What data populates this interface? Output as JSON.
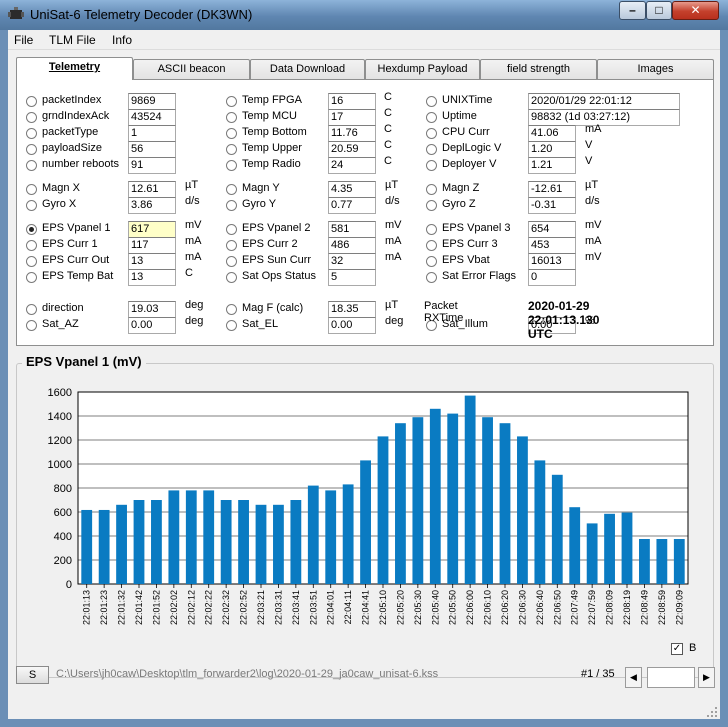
{
  "window": {
    "title": "UniSat-6 Telemetry Decoder (DK3WN)",
    "min_glyph": "–",
    "max_glyph": "□",
    "close_glyph": "✕"
  },
  "menu": {
    "items": [
      "File",
      "TLM File",
      "Info"
    ]
  },
  "tabs": [
    {
      "label": "Telemetry",
      "active": true
    },
    {
      "label": "ASCII beacon"
    },
    {
      "label": "Data Download"
    },
    {
      "label": "Hexdump Payload"
    },
    {
      "label": "field strength"
    },
    {
      "label": "Images"
    }
  ],
  "fields": {
    "col1": [
      {
        "label": "packetIndex",
        "value": "9869"
      },
      {
        "label": "grndIndexAck",
        "value": "43524"
      },
      {
        "label": "packetType",
        "value": "1"
      },
      {
        "label": "payloadSize",
        "value": "56"
      },
      {
        "label": "number reboots",
        "value": "91"
      }
    ],
    "col2": [
      {
        "label": "Temp FPGA",
        "value": "16",
        "unit": "C"
      },
      {
        "label": "Temp MCU",
        "value": "17",
        "unit": "C"
      },
      {
        "label": "Temp Bottom",
        "value": "11.76",
        "unit": "C"
      },
      {
        "label": "Temp Upper",
        "value": "20.59",
        "unit": "C"
      },
      {
        "label": "Temp Radio",
        "value": "24",
        "unit": "C"
      }
    ],
    "col3": [
      {
        "label": "UNIXTime",
        "value": "2020/01/29 22:01:12"
      },
      {
        "label": "Uptime",
        "value": "98832  (1d 03:27:12)"
      },
      {
        "label": "CPU Curr",
        "value": "41.06",
        "unit": "mA"
      },
      {
        "label": "DeplLogic V",
        "value": "1.20",
        "unit": "V"
      },
      {
        "label": "Deployer V",
        "value": "1.21",
        "unit": "V"
      }
    ],
    "magn": [
      {
        "label": "Magn X",
        "value": "12.61",
        "unit": "µT"
      },
      {
        "label": "Gyro X",
        "value": "3.86",
        "unit": "d/s"
      },
      {
        "label": "Magn Y",
        "value": "4.35",
        "unit": "µT"
      },
      {
        "label": "Gyro Y",
        "value": "0.77",
        "unit": "d/s"
      },
      {
        "label": "Magn Z",
        "value": "-12.61",
        "unit": "µT"
      },
      {
        "label": "Gyro Z",
        "value": "-0.31",
        "unit": "d/s"
      }
    ],
    "eps1": [
      {
        "label": "EPS Vpanel 1",
        "value": "617",
        "unit": "mV",
        "selected": true
      },
      {
        "label": "EPS Curr 1",
        "value": "117",
        "unit": "mA"
      },
      {
        "label": "EPS Curr Out",
        "value": "13",
        "unit": "mA"
      },
      {
        "label": "EPS Temp Bat",
        "value": "13",
        "unit": "C"
      }
    ],
    "eps2": [
      {
        "label": "EPS Vpanel 2",
        "value": "581",
        "unit": "mV"
      },
      {
        "label": "EPS Curr 2",
        "value": "486",
        "unit": "mA"
      },
      {
        "label": "EPS Sun Curr",
        "value": "32",
        "unit": "mA"
      },
      {
        "label": "Sat Ops Status",
        "value": "5"
      }
    ],
    "eps3": [
      {
        "label": "EPS Vpanel 3",
        "value": "654",
        "unit": "mV"
      },
      {
        "label": "EPS Curr 3",
        "value": "453",
        "unit": "mA"
      },
      {
        "label": "EPS Vbat",
        "value": "16013",
        "unit": "mV"
      },
      {
        "label": "Sat Error Flags",
        "value": "0"
      }
    ],
    "dir": [
      {
        "label": "direction",
        "value": "19.03",
        "unit": "deg"
      },
      {
        "label": "Sat_AZ",
        "value": "0.00",
        "unit": "deg"
      },
      {
        "label": "Mag F (calc)",
        "value": "18.35",
        "unit": "µT"
      },
      {
        "label": "Sat_EL",
        "value": "0.00",
        "unit": "deg"
      },
      {
        "label": "Sat_Illum",
        "value": "0.00",
        "unit": "%"
      }
    ],
    "rx": {
      "label": "Packet RXTime",
      "value": "2020-01-29 22:01:13.130 UTC"
    }
  },
  "chart_data": {
    "type": "bar",
    "title": "EPS Vpanel 1 (mV)",
    "categories": [
      "22:01:13",
      "22:01:23",
      "22:01:32",
      "22:01:42",
      "22:01:52",
      "22:02:02",
      "22:02:12",
      "22:02:22",
      "22:02:32",
      "22:02:52",
      "22:03:21",
      "22:03:31",
      "22:03:41",
      "22:03:51",
      "22:04:01",
      "22:04:11",
      "22:04:41",
      "22:05:10",
      "22:05:20",
      "22:05:30",
      "22:05:40",
      "22:05:50",
      "22:06:00",
      "22:06:10",
      "22:06:20",
      "22:06:30",
      "22:06:40",
      "22:06:50",
      "22:07:49",
      "22:07:59",
      "22:08:09",
      "22:08:19",
      "22:08:49",
      "22:08:59",
      "22:09:09"
    ],
    "values": [
      617,
      617,
      660,
      700,
      700,
      780,
      780,
      780,
      700,
      700,
      660,
      660,
      700,
      820,
      780,
      830,
      1030,
      1230,
      1340,
      1390,
      1460,
      1420,
      1570,
      1390,
      1340,
      1230,
      1030,
      910,
      640,
      505,
      585,
      595,
      375,
      375,
      375
    ],
    "ylim": [
      0,
      1600
    ],
    "yticks": [
      0,
      200,
      400,
      600,
      800,
      1000,
      1200,
      1400,
      1600
    ],
    "grid": true,
    "bar_color": "#0a7bc2"
  },
  "chart_options": {
    "checkbox_label": "B",
    "checkbox_checked": true,
    "check_glyph": "✓"
  },
  "status": {
    "button_label": "S",
    "path": "C:\\Users\\jh0caw\\Desktop\\tlm_forwarder2\\log\\2020-01-29_ja0caw_unisat-6.kss",
    "packet_count": "#1 / 35",
    "scroll_left_glyph": "◀",
    "scroll_right_glyph": "▶"
  }
}
